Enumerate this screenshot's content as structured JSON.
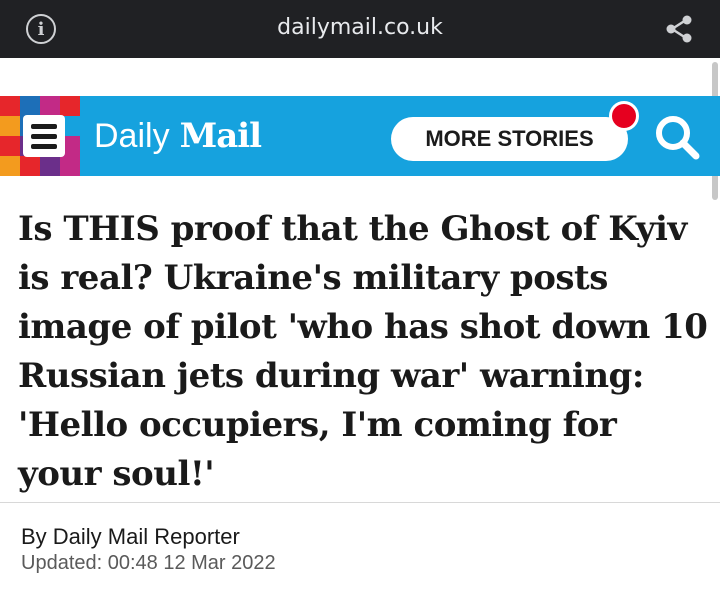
{
  "browser": {
    "url": "dailymail.co.uk",
    "left_icon": "info-icon",
    "right_icon": "share-icon"
  },
  "header": {
    "brand_first": "Daily",
    "brand_second": "Mail",
    "more_stories_label": "MORE STORIES",
    "menu_icon": "hamburger-menu-icon",
    "search_icon": "search-icon",
    "accent_color": "#16a2de",
    "notification_color": "#e6001f",
    "mosaic_colors": [
      "#e6262b",
      "#1d6fb8",
      "#c22a86",
      "#e6262b",
      "#f39b1e",
      "#1d6fb8",
      "#c22a86",
      "#16a2de",
      "#e6262b",
      "#6b2f8a",
      "#1d6fb8",
      "#c22a86",
      "#f39b1e",
      "#e6262b",
      "#6b2f8a",
      "#c22a86"
    ]
  },
  "article": {
    "headline": "Is THIS proof that the Ghost of Kyiv is real? Ukraine's military posts image of pilot 'who has shot down 10 Russian jets during war' warning: 'Hello occupiers, I'm coming for your soul!'",
    "byline": "By Daily Mail Reporter",
    "updated": "Updated: 00:48 12 Mar 2022"
  }
}
